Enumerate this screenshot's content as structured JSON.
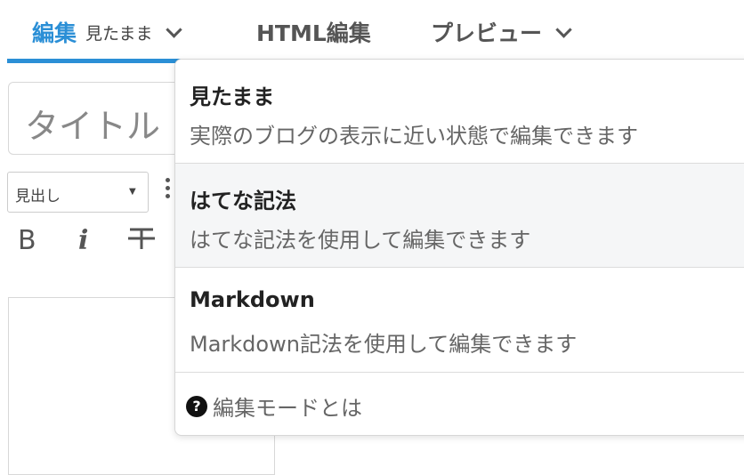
{
  "tabs": {
    "edit_label": "編集",
    "edit_mode": "見たまま",
    "html_label": "HTML編集",
    "preview_label": "プレビュー"
  },
  "title": {
    "placeholder": "タイトル"
  },
  "toolbar": {
    "heading_select": "見出し",
    "bold": "B",
    "italic": "i",
    "strike": "〒"
  },
  "dropdown": {
    "options": [
      {
        "name": "見たまま",
        "desc": "実際のブログの表示に近い状態で編集できます"
      },
      {
        "name": "はてな記法",
        "desc": "はてな記法を使用して編集できます"
      },
      {
        "name": "Markdown",
        "desc": "Markdown記法を使用して編集できます"
      }
    ],
    "help_label": "編集モードとは",
    "help_icon": "?"
  }
}
